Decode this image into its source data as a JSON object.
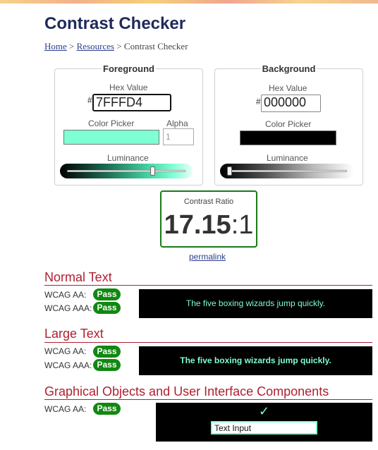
{
  "page": {
    "title": "Contrast Checker"
  },
  "breadcrumb": {
    "home": "Home",
    "separator1": ">",
    "resources": "Resources",
    "separator2": ">",
    "current": "Contrast Checker"
  },
  "foreground": {
    "legend": "Foreground",
    "hex_label": "Hex Value",
    "hash": "#",
    "hex_value": "7FFFD4",
    "color_picker_label": "Color Picker",
    "color": "#7fffd4",
    "alpha_label": "Alpha",
    "alpha_placeholder": "1",
    "luminance_label": "Luminance",
    "luminance_level": 0.73
  },
  "background": {
    "legend": "Background",
    "hex_label": "Hex Value",
    "hash": "#",
    "hex_value": "000000",
    "color_picker_label": "Color Picker",
    "color": "#000000",
    "luminance_label": "Luminance",
    "luminance_level": 0.0
  },
  "contrast": {
    "label": "Contrast Ratio",
    "value": "17.15",
    "suffix": ":1",
    "border_color": "#1a7a1a"
  },
  "permalink": "permalink",
  "normal_text": {
    "title": "Normal Text",
    "aa_label": "WCAG AA:",
    "aa_result": "Pass",
    "aaa_label": "WCAG AAA:",
    "aaa_result": "Pass",
    "sample": "The five boxing wizards jump quickly."
  },
  "large_text": {
    "title": "Large Text",
    "aa_label": "WCAG AA:",
    "aa_result": "Pass",
    "aaa_label": "WCAG AAA:",
    "aaa_result": "Pass",
    "sample": "The five boxing wizards jump quickly."
  },
  "graphical": {
    "title": "Graphical Objects and User Interface Components",
    "aa_label": "WCAG AA:",
    "aa_result": "Pass",
    "check_glyph": "✓",
    "input_value": "Text Input"
  },
  "colors": {
    "heading": "#1f2a5c",
    "section": "#b02030",
    "pass": "#118811",
    "link": "#2a3f8f"
  }
}
